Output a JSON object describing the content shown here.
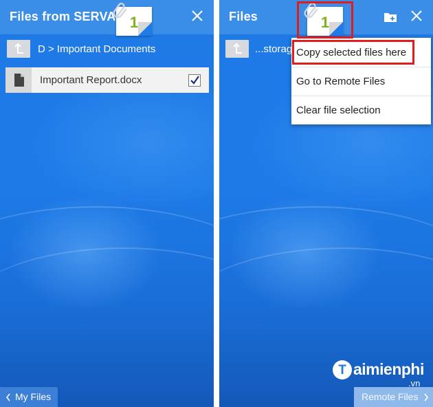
{
  "left": {
    "title": "Files from SERVAL",
    "selection_count": "1",
    "path": "D > Important Documents",
    "file": {
      "name": "Important Report.docx",
      "checked": true
    },
    "bottom_button": "My Files",
    "icons": [
      "paperclip-icon",
      "close-icon",
      "up-arrow-icon",
      "document-icon",
      "checkmark-icon",
      "chevron-left-icon"
    ]
  },
  "right": {
    "title": "Files",
    "selection_count": "1",
    "path": "...storag",
    "bottom_button": "Remote Files",
    "menu": [
      {
        "label": "Copy selected files here"
      },
      {
        "label": "Go to Remote Files"
      },
      {
        "label": "Clear file selection"
      }
    ],
    "icons": [
      "paperclip-icon",
      "folder-add-icon",
      "close-icon",
      "up-arrow-icon",
      "chevron-right-icon"
    ]
  },
  "watermark": {
    "brand": "aimienphi",
    "brand_initial": "T",
    "tld": ".vn"
  },
  "colors": {
    "titlebar": "#3b8ee8",
    "background": "#1e7be8",
    "count_green": "#7fb31c",
    "highlight_red": "#e21b1b"
  }
}
